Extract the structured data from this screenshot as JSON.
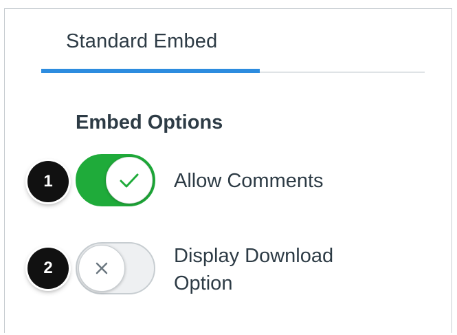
{
  "tabs": [
    {
      "label": "Standard Embed",
      "active": true
    }
  ],
  "section": {
    "title": "Embed Options"
  },
  "options": [
    {
      "badge": "1",
      "label": "Allow Comments",
      "enabled": true,
      "icon": "check-icon"
    },
    {
      "badge": "2",
      "label_line1": "Display Download",
      "label_line2": "Option",
      "enabled": false,
      "icon": "x-icon"
    }
  ],
  "colors": {
    "accent": "#2d8cdf",
    "toggle_on": "#1fab3a",
    "text": "#2d3b45"
  }
}
